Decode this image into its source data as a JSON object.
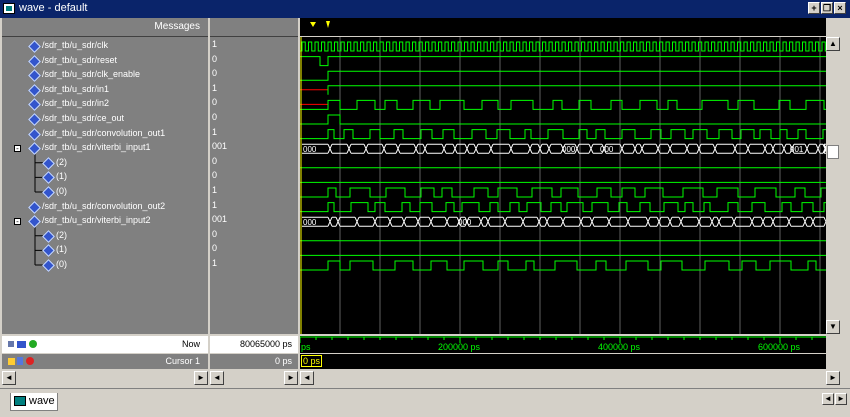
{
  "window": {
    "title": "wave - default",
    "minimize": "+",
    "restore": "❐",
    "close": "×"
  },
  "header": {
    "messages": "Messages"
  },
  "signals": [
    {
      "name": "/sdr_tb/u_sdr/clk",
      "value": "1",
      "indent": 0
    },
    {
      "name": "/sdr_tb/u_sdr/reset",
      "value": "0",
      "indent": 0
    },
    {
      "name": "/sdr_tb/u_sdr/clk_enable",
      "value": "0",
      "indent": 0
    },
    {
      "name": "/sdr_tb/u_sdr/in1",
      "value": "1",
      "indent": 0
    },
    {
      "name": "/sdr_tb/u_sdr/in2",
      "value": "0",
      "indent": 0
    },
    {
      "name": "/sdr_tb/u_sdr/ce_out",
      "value": "0",
      "indent": 0
    },
    {
      "name": "/sdr_tb/u_sdr/convolution_out1",
      "value": "1",
      "indent": 0
    },
    {
      "name": "/sdr_tb/u_sdr/viterbi_input1",
      "value": "001",
      "indent": 0,
      "expander": "-"
    },
    {
      "name": "(2)",
      "value": "0",
      "indent": 1
    },
    {
      "name": "(1)",
      "value": "0",
      "indent": 1
    },
    {
      "name": "(0)",
      "value": "1",
      "indent": 1
    },
    {
      "name": "/sdr_tb/u_sdr/convolution_out2",
      "value": "1",
      "indent": 0
    },
    {
      "name": "/sdr_tb/u_sdr/viterbi_input2",
      "value": "001",
      "indent": 0,
      "expander": "-"
    },
    {
      "name": "(2)",
      "value": "0",
      "indent": 1
    },
    {
      "name": "(1)",
      "value": "0",
      "indent": 1
    },
    {
      "name": "(0)",
      "value": "1",
      "indent": 1
    }
  ],
  "bus_labels": {
    "viterbi_input1": [
      "000",
      "000",
      "000",
      "001"
    ],
    "viterbi_input2": [
      "000",
      "000"
    ]
  },
  "footer": {
    "now_label": "Now",
    "now_value": "80065000 ps",
    "cursor_label": "Cursor 1",
    "cursor_value": "0 ps",
    "cursor_time": "0 ps",
    "ticks": [
      "ps",
      "200000 ps",
      "400000 ps",
      "600000 ps"
    ]
  },
  "tabs": [
    {
      "label": "wave"
    }
  ],
  "colors": {
    "wave": "#00ff00",
    "bg": "#000000",
    "panel": "#808080",
    "title": "#0a246a",
    "unknown": "#ff0000"
  }
}
